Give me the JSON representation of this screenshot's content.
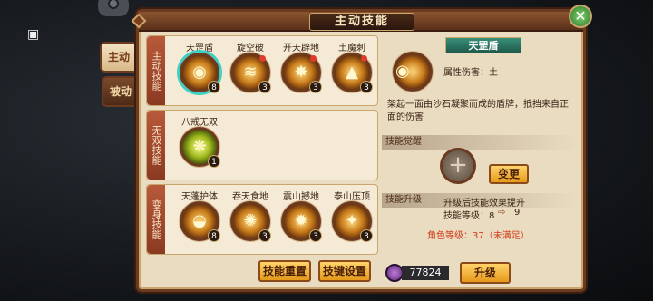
{
  "window": {
    "title": "主动技能",
    "close_symbol": "✕"
  },
  "side_tabs": [
    {
      "label": "主动",
      "active": true
    },
    {
      "label": "被动",
      "active": false
    }
  ],
  "sections": {
    "active": {
      "label": "主动技能",
      "skills": [
        {
          "name": "天罡盾",
          "level": "8",
          "selected": true,
          "new": false
        },
        {
          "name": "旋空破",
          "level": "3",
          "selected": false,
          "new": true
        },
        {
          "name": "开天辟地",
          "level": "3",
          "selected": false,
          "new": true
        },
        {
          "name": "土魔刺",
          "level": "3",
          "selected": false,
          "new": true
        }
      ]
    },
    "ultimate": {
      "label": "无双技能",
      "skills": [
        {
          "name": "八戒无双",
          "level": "1"
        }
      ]
    },
    "transform": {
      "label": "变身技能",
      "skills": [
        {
          "name": "天蓬护体",
          "level": "8"
        },
        {
          "name": "吞天食地",
          "level": "3"
        },
        {
          "name": "震山撼地",
          "level": "3"
        },
        {
          "name": "泰山压顶",
          "level": "3"
        }
      ]
    }
  },
  "buttons": {
    "reset": "技能重置",
    "keys": "技键设置",
    "change": "变更",
    "upgrade": "升级"
  },
  "detail": {
    "name": "天罡盾",
    "attribute": "属性伤害：土",
    "description": "架起一面由沙石凝聚而成的盾牌，抵挡来自正面的伤害",
    "awaken_header": "技能觉醒",
    "upgrade_header": "技能升级",
    "upgrade_effect": "升级后技能效果提升",
    "level_from": "技能等级：8",
    "level_to": "9",
    "role_level": "角色等级：37（未满足）"
  },
  "currency": {
    "amount": "77824"
  },
  "colors": {
    "accent": "#e59a1a",
    "frame": "#6b3a1f",
    "warning": "#d23a1a"
  }
}
